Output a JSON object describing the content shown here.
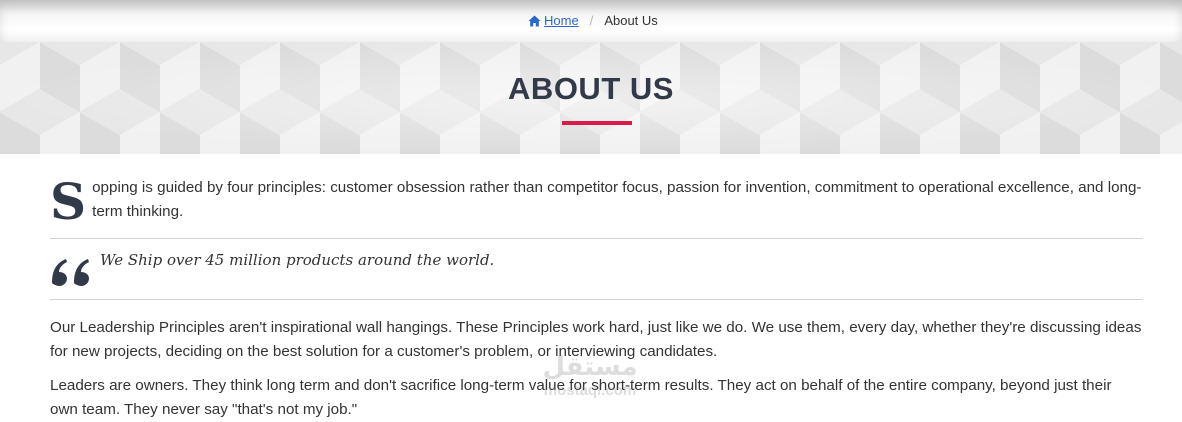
{
  "breadcrumb": {
    "home_label": "Home",
    "separator": "/",
    "current_label": "About Us",
    "home_icon": "home-icon",
    "link_color": "#2b68c9"
  },
  "hero": {
    "title": "ABOUT US",
    "accent_color": "#d81b4a",
    "title_color": "#323a4a"
  },
  "intro": {
    "dropcap": "S",
    "text": "opping is guided by four principles: customer obsession rather than competitor focus, passion for invention, commitment to operational excellence, and long-term thinking."
  },
  "quote": {
    "icon": "quote-icon",
    "text": "We Ship over 45 million products around the world."
  },
  "paragraphs": [
    "Our Leadership Principles aren't inspirational wall hangings. These Principles work hard, just like we do. We use them, every day, whether they're discussing ideas for new projects, deciding on the best solution for a customer's problem, or interviewing candidates.",
    "Leaders are owners. They think long term and don't sacrifice long-term value for short-term results. They act on behalf of the entire company, beyond just their own team. They never say \"that's not my job.\""
  ],
  "watermark": {
    "logo_text": "مستقل",
    "site_text": "mostaql.com"
  }
}
